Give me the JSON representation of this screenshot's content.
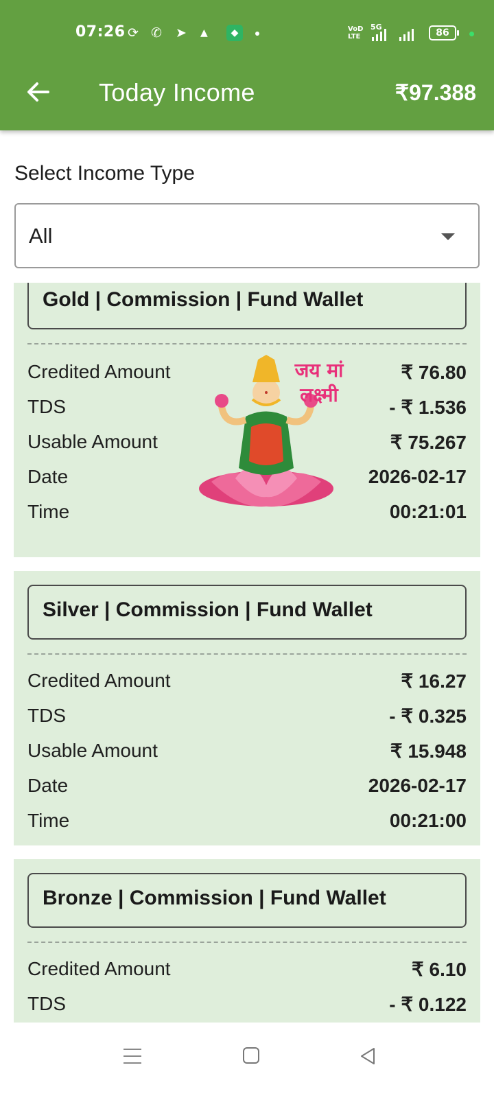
{
  "status_bar": {
    "time": "07:26",
    "network": "5G",
    "volte": "VoD LTE",
    "battery": "86"
  },
  "app_bar": {
    "title": "Today Income",
    "balance": "₹97.388"
  },
  "filter": {
    "label": "Select Income Type",
    "selected": "All"
  },
  "watermark": {
    "line1": "जय मां",
    "line2": "लक्ष्मी"
  },
  "cards": [
    {
      "title": "Gold | Commission | Fund Wallet",
      "rows": [
        {
          "label": "Credited Amount",
          "value": "₹ 76.80"
        },
        {
          "label": "TDS",
          "value": "- ₹ 1.536"
        },
        {
          "label": "Usable Amount",
          "value": "₹ 75.267"
        },
        {
          "label": "Date",
          "value": "2026-02-17"
        },
        {
          "label": "Time",
          "value": "00:21:01"
        }
      ]
    },
    {
      "title": "Silver | Commission | Fund Wallet",
      "rows": [
        {
          "label": "Credited Amount",
          "value": "₹ 16.27"
        },
        {
          "label": "TDS",
          "value": "- ₹ 0.325"
        },
        {
          "label": "Usable Amount",
          "value": "₹ 15.948"
        },
        {
          "label": "Date",
          "value": "2026-02-17"
        },
        {
          "label": "Time",
          "value": "00:21:00"
        }
      ]
    },
    {
      "title": "Bronze | Commission | Fund Wallet",
      "rows": [
        {
          "label": "Credited Amount",
          "value": "₹ 6.10"
        },
        {
          "label": "TDS",
          "value": "- ₹ 0.122"
        }
      ]
    }
  ],
  "colors": {
    "app_bar": "#63a041",
    "card_bg": "#dfeedb"
  }
}
